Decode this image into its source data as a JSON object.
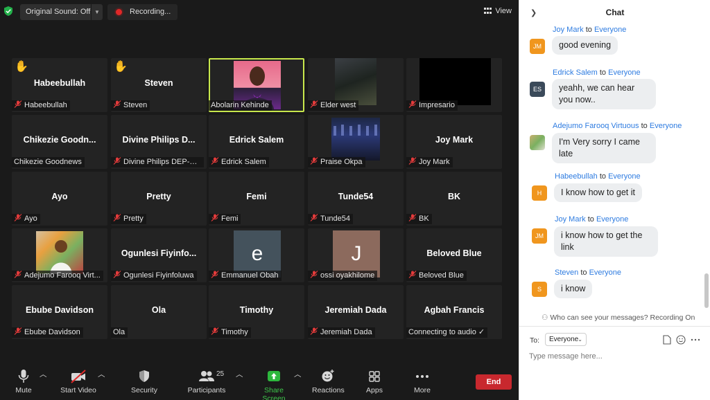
{
  "topbar": {
    "original_sound": "Original Sound: Off",
    "recording": "Recording...",
    "view": "View"
  },
  "tiles": [
    {
      "name": "Habeebullah",
      "label": "Habeebullah",
      "hand": true,
      "muted": true
    },
    {
      "name": "Steven",
      "label": "Steven",
      "hand": true,
      "muted": true
    },
    {
      "name": "",
      "label": "Abolarin Kehinde",
      "hand": false,
      "muted": false,
      "active": true,
      "video": "photo-purple"
    },
    {
      "name": "",
      "label": "Elder west",
      "hand": false,
      "muted": true,
      "video": "dark-photo"
    },
    {
      "name": "",
      "label": "Impresario",
      "hand": false,
      "muted": true,
      "video": "black"
    },
    {
      "name": "Chikezie  Goodn...",
      "label": "Chikezie Goodnews",
      "hand": false,
      "muted": false
    },
    {
      "name": "Divine  Philips  D...",
      "label": "Divine Philips DEP-EXI...",
      "hand": false,
      "muted": true
    },
    {
      "name": "Edrick Salem",
      "label": "Edrick Salem",
      "hand": false,
      "muted": true
    },
    {
      "name": "",
      "label": "Praise Okpa",
      "hand": false,
      "muted": true,
      "video": "blue-photo"
    },
    {
      "name": "Joy Mark",
      "label": "Joy Mark",
      "hand": false,
      "muted": true
    },
    {
      "name": "Ayo",
      "label": "Ayo",
      "hand": false,
      "muted": true
    },
    {
      "name": "Pretty",
      "label": "Pretty",
      "hand": false,
      "muted": true
    },
    {
      "name": "Femi",
      "label": "Femi",
      "hand": false,
      "muted": true
    },
    {
      "name": "Tunde54",
      "label": "Tunde54",
      "hand": false,
      "muted": true
    },
    {
      "name": "BK",
      "label": "BK",
      "hand": false,
      "muted": true
    },
    {
      "name": "",
      "label": "Adejumo Farooq Virt...",
      "hand": false,
      "muted": true,
      "video": "portrait-photo"
    },
    {
      "name": "Ogunlesi  Fiyinfo...",
      "label": "Ogunlesi Fiyinfoluwa",
      "hand": false,
      "muted": true
    },
    {
      "name": "",
      "label": "Emmanuel Obah",
      "hand": false,
      "muted": true,
      "avatar_letter": "e",
      "avatar_color": "#44525c"
    },
    {
      "name": "",
      "label": "ossi oyakhilome",
      "hand": false,
      "muted": true,
      "avatar_letter": "J",
      "avatar_color": "#8c6a5d"
    },
    {
      "name": "Beloved Blue",
      "label": "Beloved Blue",
      "hand": false,
      "muted": true
    },
    {
      "name": "Ebube Davidson",
      "label": "Ebube Davidson",
      "hand": false,
      "muted": true
    },
    {
      "name": "Ola",
      "label": "Ola",
      "hand": false,
      "muted": false
    },
    {
      "name": "Timothy",
      "label": "Timothy",
      "hand": false,
      "muted": true
    },
    {
      "name": "Jeremiah Dada",
      "label": "Jeremiah Dada",
      "hand": false,
      "muted": true
    },
    {
      "name": "Agbah Francis",
      "label": "Connecting to audio ✓",
      "hand": false,
      "muted": false
    }
  ],
  "controls": {
    "mute": "Mute",
    "start_video": "Start Video",
    "security": "Security",
    "participants": "Participants",
    "participants_count": "25",
    "share_screen": "Share Screen",
    "reactions": "Reactions",
    "apps": "Apps",
    "more": "More",
    "end": "End"
  },
  "chat": {
    "title": "Chat",
    "to_word": "to",
    "messages": [
      {
        "sender": "Joy Mark",
        "recipient": "Everyone",
        "initials": "JM",
        "color": "#f0961e",
        "text": "good evening"
      },
      {
        "sender": "Edrick Salem",
        "recipient": "Everyone",
        "initials": "ES",
        "color": "#3b4a5a",
        "text": "yeahh, we can hear you now.."
      },
      {
        "sender": "Adejumo Farooq Virtuous",
        "recipient": "Everyone",
        "initials": "",
        "color": "#9aa86a",
        "text": "I'm Very sorry I came late"
      },
      {
        "sender": "Habeebullah",
        "recipient": "Everyone",
        "initials": "H",
        "color": "#f0961e",
        "text": "I know how to get it"
      },
      {
        "sender": "Joy Mark",
        "recipient": "Everyone",
        "initials": "JM",
        "color": "#f0961e",
        "text": "i know how to get the link"
      },
      {
        "sender": "Steven",
        "recipient": "Everyone",
        "initials": "S",
        "color": "#f0961e",
        "text": "i know"
      }
    ],
    "privacy": "Who can see your messages? Recording On",
    "to_label": "To:",
    "to_value": "Everyone",
    "input_placeholder": "Type message here..."
  }
}
